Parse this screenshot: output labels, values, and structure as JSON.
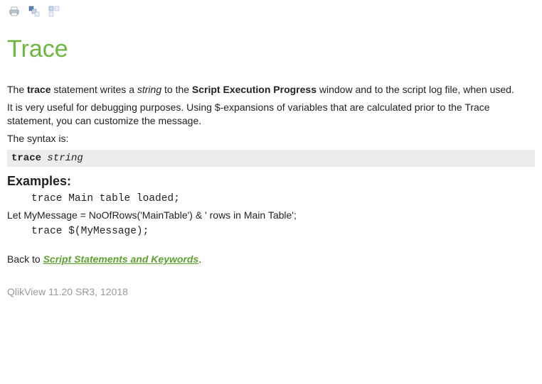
{
  "toolbar": {
    "print_icon": "print-icon",
    "expand_icon": "expand-all-icon",
    "collapse_icon": "collapse-all-icon"
  },
  "title": "Trace",
  "para1": {
    "t1": "The ",
    "bold1": "trace",
    "t2": " statement writes a ",
    "italic1": "string",
    "t3": " to the ",
    "bold2": "Script Execution Progress",
    "t4": " window and to the script log file, when used."
  },
  "para2": "It is very useful for debugging purposes. Using $-expansions of variables that are calculated prior to the Trace statement, you can customize the message.",
  "para3": "The syntax is:",
  "syntax": {
    "kw": "trace",
    "arg": "string"
  },
  "examples_heading": "Examples:",
  "example1": "trace Main table loaded;",
  "example_let": "Let MyMessage = NoOfRows('MainTable') & ' rows in Main Table';",
  "example2": "trace $(MyMessage);",
  "back": {
    "prefix": "Back to ",
    "link": "Script Statements and Keywords",
    "suffix": "."
  },
  "version": "QlikView 11.20 SR3, 12018"
}
